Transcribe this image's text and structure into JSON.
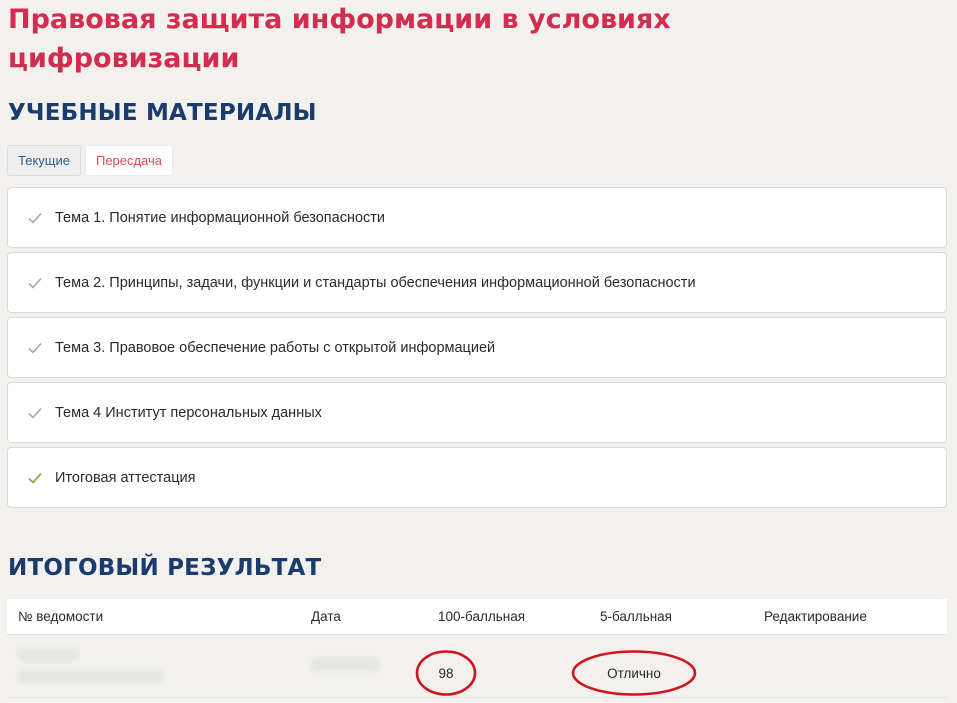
{
  "course": {
    "title": "Правовая защита информации в условиях цифровизации"
  },
  "materials": {
    "heading": "УЧЕБНЫЕ МАТЕРИАЛЫ",
    "tabs": [
      {
        "label": "Текущие",
        "active": true
      },
      {
        "label": "Пересдача",
        "active": false
      }
    ],
    "topics": [
      {
        "label": "Тема 1. Понятие информационной безопасности",
        "status_icon": "check-icon",
        "check_color": "#a8a8a8"
      },
      {
        "label": "Тема 2. Принципы, задачи, функции и стандарты обеспечения информационной безопасности",
        "status_icon": "check-icon",
        "check_color": "#a8a8a8"
      },
      {
        "label": "Тема 3. Правовое обеспечение работы с открытой информацией",
        "status_icon": "check-icon",
        "check_color": "#a8a8a8"
      },
      {
        "label": "Тема 4 Институт персональных данных",
        "status_icon": "check-icon",
        "check_color": "#a8a8a8"
      },
      {
        "label": "Итоговая аттестация",
        "status_icon": "check-icon",
        "check_color": "#7cb342"
      }
    ]
  },
  "results": {
    "heading": "ИТОГОВЫЙ РЕЗУЛЬТАТ",
    "columns": [
      "№ ведомости",
      "Дата",
      "100-балльная",
      "5-балльная",
      "Редактирование"
    ],
    "rows": [
      {
        "score_100": "98",
        "score_5": "Отлично",
        "edit": ""
      }
    ],
    "highlight_color": "#d0141e"
  },
  "colors": {
    "title_red": "#d42c4f",
    "heading_blue": "#1a3b6e",
    "background": "#f2f1ee"
  }
}
